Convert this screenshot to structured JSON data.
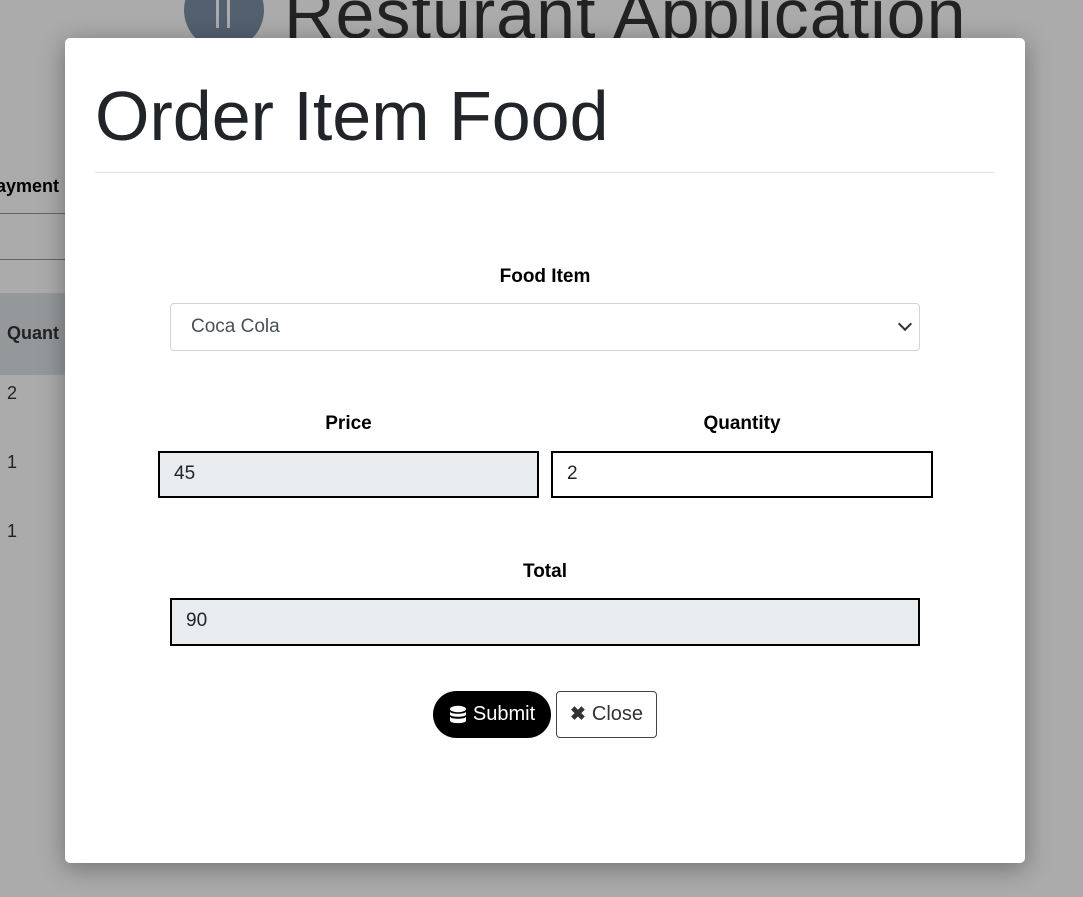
{
  "background": {
    "app_title": "Resturant Application",
    "column_header": "ayment",
    "table_header": "Quant",
    "rows": [
      "2",
      "1",
      "1"
    ]
  },
  "modal": {
    "title": "Order Item Food",
    "food_item": {
      "label": "Food Item",
      "selected": "Coca Cola"
    },
    "price": {
      "label": "Price",
      "value": "45"
    },
    "quantity": {
      "label": "Quantity",
      "value": "2"
    },
    "total": {
      "label": "Total",
      "value": "90"
    },
    "submit_label": "Submit",
    "close_label": "Close"
  },
  "colors": {
    "submit_bg": "#000000",
    "readonly_bg": "#e9ecef",
    "overlay": "rgba(0,0,0,0.33)"
  },
  "icons": {
    "submit": "database-icon",
    "close": "times-icon"
  }
}
